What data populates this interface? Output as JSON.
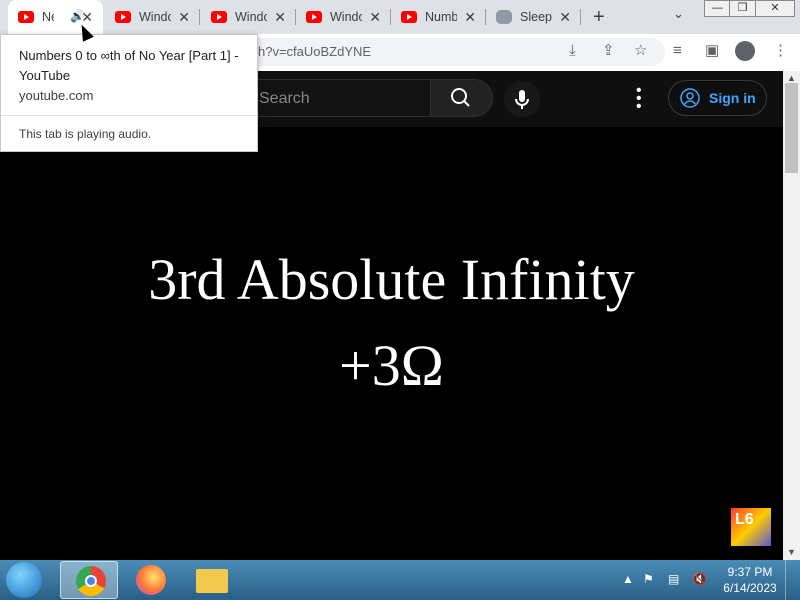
{
  "tabs": [
    {
      "title": "Ne",
      "favicon": "youtube-icon",
      "audio": true,
      "active": true
    },
    {
      "title": "Windo",
      "favicon": "youtube-icon"
    },
    {
      "title": "Windo",
      "favicon": "youtube-icon"
    },
    {
      "title": "Windo",
      "favicon": "youtube-icon"
    },
    {
      "title": "Numb",
      "favicon": "youtube-icon"
    },
    {
      "title": "Sleep",
      "favicon": "cat-icon"
    }
  ],
  "tab_close_glyph": "✕",
  "new_tab_glyph": "+",
  "tab_search_glyph": "⌄",
  "window": {
    "minimize": "—",
    "maximize": "❐",
    "close": "✕"
  },
  "address": {
    "url": "h?v=cfaUoBZdYNE"
  },
  "tooltip": {
    "title": "Numbers 0 to ∞th of No Year [Part 1] - YouTube",
    "domain": "youtube.com",
    "status": "This tab is playing audio."
  },
  "youtube": {
    "search_placeholder": "Search",
    "signin_label": "Sign in"
  },
  "video": {
    "line1": "3rd Absolute Infinity",
    "line2": "+3Ω",
    "watermark": "L6"
  },
  "taskbar": {
    "time": "9:37 PM",
    "date": "6/14/2023"
  },
  "colors": {
    "youtube_red": "#ff0000",
    "signin_blue": "#3ea6ff",
    "taskbar": "#2a5f86"
  }
}
